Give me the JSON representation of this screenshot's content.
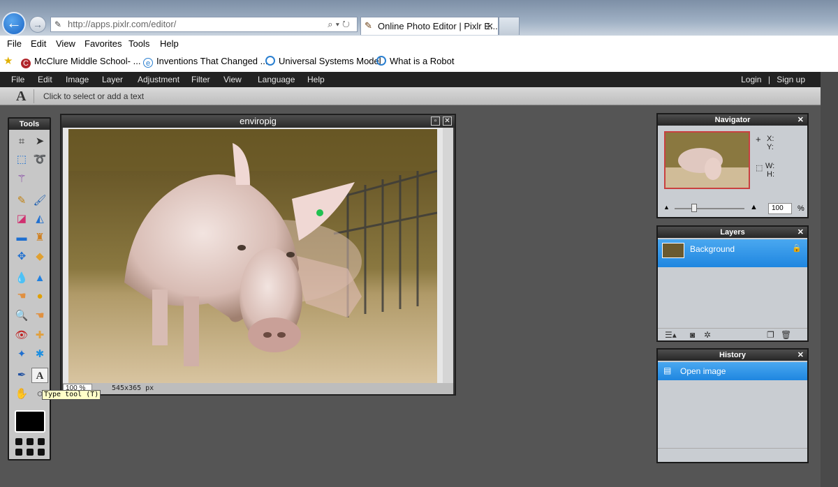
{
  "browser": {
    "address": "http://apps.pixlr.com/editor/",
    "tab_title": "Online Photo Editor | Pixlr E...",
    "tab_close": "✕",
    "menu": [
      "File",
      "Edit",
      "View",
      "Favorites",
      "Tools",
      "Help"
    ],
    "favorites": [
      {
        "label": "McClure Middle School- ...",
        "icon": "school-icon",
        "color": "#b0242a"
      },
      {
        "label": "Inventions That Changed ...",
        "icon": "ie-icon",
        "color": "#2a7fd0"
      },
      {
        "label": "Universal Systems Model",
        "icon": "globe-icon",
        "color": "#2a7fd0"
      },
      {
        "label": "What is a Robot",
        "icon": "globe-icon",
        "color": "#2a7fd0"
      }
    ]
  },
  "pixlr": {
    "menu": [
      "File",
      "Edit",
      "Image",
      "Layer",
      "Adjustment",
      "Filter",
      "View",
      "Language",
      "Help"
    ],
    "login": "Login",
    "separator": "|",
    "signup": "Sign up",
    "options_hint": "Click to select or add a text",
    "tools_title": "Tools",
    "tooltip": "Type tool (T)",
    "document": {
      "title": "enviropig",
      "zoom": "100 %",
      "dimensions": "545x365 px"
    },
    "navigator": {
      "title": "Navigator",
      "x_label": "X:",
      "y_label": "Y:",
      "w_label": "W:",
      "h_label": "H:",
      "zoom_value": "100",
      "zoom_unit": "%"
    },
    "layers": {
      "title": "Layers",
      "items": [
        {
          "name": "Background",
          "locked": true
        }
      ]
    },
    "history": {
      "title": "History",
      "items": [
        {
          "name": "Open image"
        }
      ]
    },
    "colors": {
      "panel_header": "#262626",
      "selection_blue": "#1f86e0",
      "primary_color": "#000000"
    }
  }
}
